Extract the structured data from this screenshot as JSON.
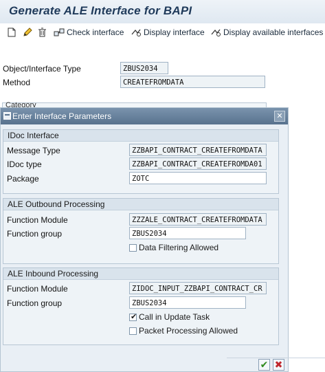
{
  "window": {
    "title": "Generate ALE Interface for BAPI"
  },
  "toolbar": {
    "check_interface": "Check interface",
    "display_interface": "Display interface",
    "display_available": "Display available interfaces"
  },
  "main": {
    "object_type_label": "Object/Interface Type",
    "object_type_value": "ZBUS2034",
    "method_label": "Method",
    "method_value": "CREATEFROMDATA",
    "category_label": "Category"
  },
  "dialog": {
    "title": "Enter Interface Parameters",
    "idoc": {
      "heading": "IDoc Interface",
      "message_type_label": "Message Type",
      "message_type_value": "ZZBAPI_CONTRACT_CREATEFROMDATA",
      "idoc_type_label": "IDoc type",
      "idoc_type_value": "ZZBAPI_CONTRACT_CREATEFROMDA01",
      "package_label": "Package",
      "package_value": "ZOTC"
    },
    "outbound": {
      "heading": "ALE Outbound Processing",
      "fm_label": "Function Module",
      "fm_value": "ZZZALE_CONTRACT_CREATEFROMDATA",
      "fg_label": "Function group",
      "fg_value": "ZBUS2034",
      "filter_label": "Data Filtering Allowed",
      "filter_checked": false
    },
    "inbound": {
      "heading": "ALE Inbound Processing",
      "fm_label": "Function Module",
      "fm_value": "ZIDOC_INPUT_ZZBAPI_CONTRACT_CR",
      "fg_label": "Function group",
      "fg_value": "ZBUS2034",
      "update_task_label": "Call in Update Task",
      "update_task_checked": true,
      "packet_label": "Packet Processing Allowed",
      "packet_checked": false
    },
    "confirm_icon": "checkmark-icon",
    "cancel_icon": "cancel-x-icon"
  },
  "colors": {
    "accent": "#58728e",
    "confirm": "#2f8a1c",
    "cancel": "#c0272d"
  }
}
